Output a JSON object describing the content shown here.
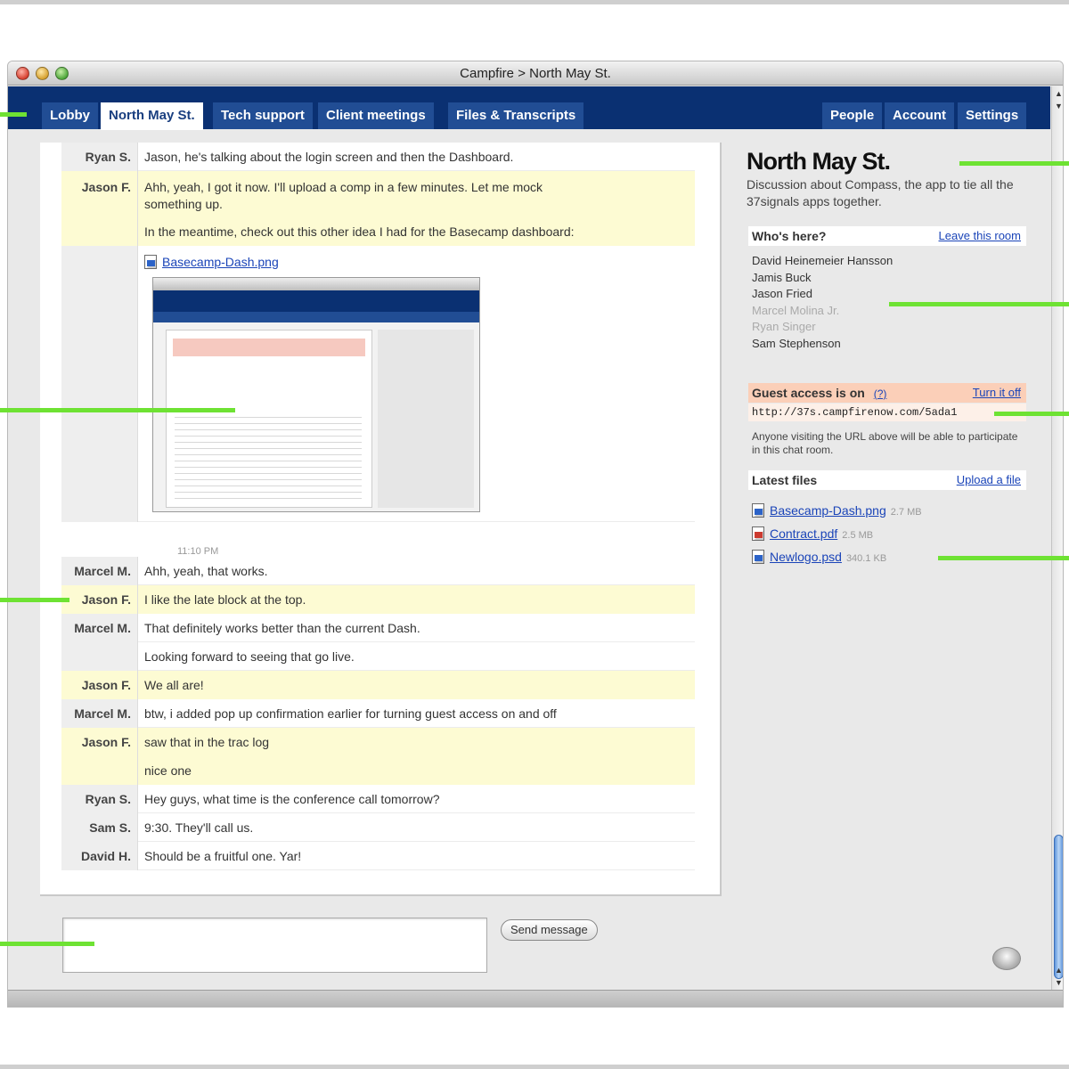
{
  "window": {
    "title": "Campfire > North May St."
  },
  "tabs_left": [
    "Lobby",
    "North May St.",
    "Tech support",
    "Client meetings",
    "Files & Transcripts"
  ],
  "tabs_right": [
    "People",
    "Account",
    "Settings"
  ],
  "chat": {
    "messages": [
      {
        "author": "Ryan S.",
        "lines": [
          "Jason, he's talking about the login screen and then the Dashboard."
        ]
      },
      {
        "author": "Jason F.",
        "lines": [
          "Ahh, yeah, I got it now. I'll upload a comp in a few minutes. Let me mock",
          "something up."
        ]
      },
      {
        "author": "",
        "lines": [
          "In the meantime, check out this other idea I had for the Basecamp dashboard:"
        ]
      },
      {
        "author": "Marcel M.",
        "lines": [
          "Ahh, yeah, that works."
        ]
      },
      {
        "author": "Jason F.",
        "lines": [
          "I like the late block at the top."
        ]
      },
      {
        "author": "Marcel M.",
        "lines": [
          "That definitely works better than the current Dash."
        ]
      },
      {
        "author": "",
        "lines": [
          "Looking forward to seeing that go live."
        ]
      },
      {
        "author": "Jason F.",
        "lines": [
          "We all are!"
        ]
      },
      {
        "author": "Marcel M.",
        "lines": [
          "btw, i added pop up confirmation earlier for turning guest access on and off"
        ]
      },
      {
        "author": "Jason F.",
        "lines": [
          "saw that in the trac log"
        ]
      },
      {
        "author": "",
        "lines": [
          "nice one"
        ]
      },
      {
        "author": "Ryan S.",
        "lines": [
          "Hey guys, what time is the conference call tomorrow?"
        ]
      },
      {
        "author": "Sam S.",
        "lines": [
          "9:30. They'll call us."
        ]
      },
      {
        "author": "David H.",
        "lines": [
          "Should be a fruitful one. Yar!"
        ]
      }
    ],
    "upload_file": "Basecamp-Dash.png",
    "timestamp": "11:10 PM"
  },
  "composer": {
    "send_label": "Send message"
  },
  "sidebar": {
    "room_name": "North May St.",
    "room_desc": "Discussion about Compass, the app to tie all the 37signals apps together.",
    "whos_here_label": "Who's here?",
    "leave_label": "Leave this room",
    "people": [
      {
        "name": "David Heinemeier Hansson",
        "idle": false
      },
      {
        "name": "Jamis Buck",
        "idle": false
      },
      {
        "name": "Jason Fried",
        "idle": false
      },
      {
        "name": "Marcel Molina Jr.",
        "idle": true
      },
      {
        "name": "Ryan Singer",
        "idle": true
      },
      {
        "name": "Sam Stephenson",
        "idle": false
      }
    ],
    "guest_label": "Guest access is on",
    "guest_help": "(?)",
    "turn_off_label": "Turn it off",
    "guest_url": "http://37s.campfirenow.com/5ada1",
    "guest_note": "Anyone visiting the URL above will be able to participate in this chat room.",
    "files_label": "Latest files",
    "upload_label": "Upload a file",
    "files": [
      {
        "name": "Basecamp-Dash.png",
        "size": "2.7 MB",
        "icon": "image-file-icon"
      },
      {
        "name": "Contract.pdf",
        "size": "2.5 MB",
        "icon": "pdf-file-icon"
      },
      {
        "name": "Newlogo.psd",
        "size": "340.1 KB",
        "icon": "image-file-icon"
      }
    ]
  },
  "colors": {
    "nav_bg": "#0a3072",
    "tab_bg": "#214d94",
    "highlight_row": "#fdfbd3",
    "guest_bg": "#fbcfb8",
    "callout": "#6ee233",
    "link": "#1a44b8"
  }
}
